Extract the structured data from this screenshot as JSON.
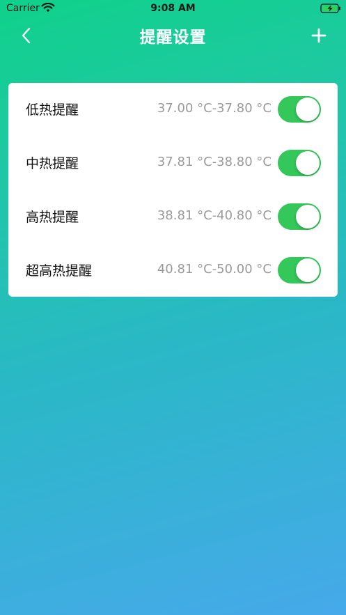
{
  "status_bar": {
    "carrier": "Carrier",
    "time": "9:08 AM",
    "wifi_icon": "wifi-icon",
    "battery_icon": "battery-charging-icon"
  },
  "nav": {
    "title": "提醒设置",
    "back_icon": "chevron-left-icon",
    "add_icon": "plus-icon"
  },
  "reminders": [
    {
      "label": "低热提醒",
      "range": "37.00 °C-37.80 °C",
      "enabled": true
    },
    {
      "label": "中热提醒",
      "range": "37.81 °C-38.80 °C",
      "enabled": true
    },
    {
      "label": "高热提醒",
      "range": "38.81 °C-40.80 °C",
      "enabled": true
    },
    {
      "label": "超高热提醒",
      "range": "40.81 °C-50.00 °C",
      "enabled": true
    }
  ],
  "colors": {
    "gradient_top": "#0fd18a",
    "gradient_bottom": "#46a9ea",
    "toggle_on": "#34c759",
    "range_text": "#9a9a9a"
  }
}
